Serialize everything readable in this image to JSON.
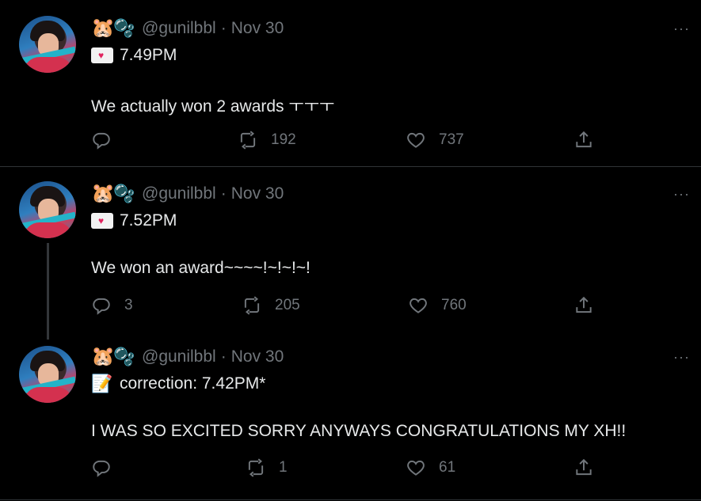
{
  "tweets": [
    {
      "handle": "@gunilbbl",
      "separator": "·",
      "date": "Nov 30",
      "line1_icon": "love-letter-icon",
      "line1_text": "7.49PM",
      "body": "We actually won 2 awards ㅜㅜㅜ",
      "replies": "",
      "retweets": "192",
      "likes": "737",
      "menu": "···"
    },
    {
      "handle": "@gunilbbl",
      "separator": "·",
      "date": "Nov 30",
      "line1_icon": "love-letter-icon",
      "line1_text": "7.52PM",
      "body": "We won an award~~~~!~!~!~!",
      "replies": "3",
      "retweets": "205",
      "likes": "760",
      "menu": "···"
    },
    {
      "handle": "@gunilbbl",
      "separator": "·",
      "date": "Nov 30",
      "line1_icon": "memo-icon",
      "line1_text": "correction: 7.42PM*",
      "body": "I WAS SO EXCITED SORRY ANYWAYS CONGRATULATIONS MY XH!!",
      "replies": "",
      "retweets": "1",
      "likes": "61",
      "menu": "···"
    }
  ],
  "icons": {
    "name_emoji_1": "🐹",
    "name_emoji_2": "🫧",
    "memo": "📝",
    "heart_in_envelope": "♥"
  },
  "colors": {
    "background": "#000000",
    "text": "#e7e9ea",
    "muted": "#71767b",
    "divider": "#2f3336"
  }
}
